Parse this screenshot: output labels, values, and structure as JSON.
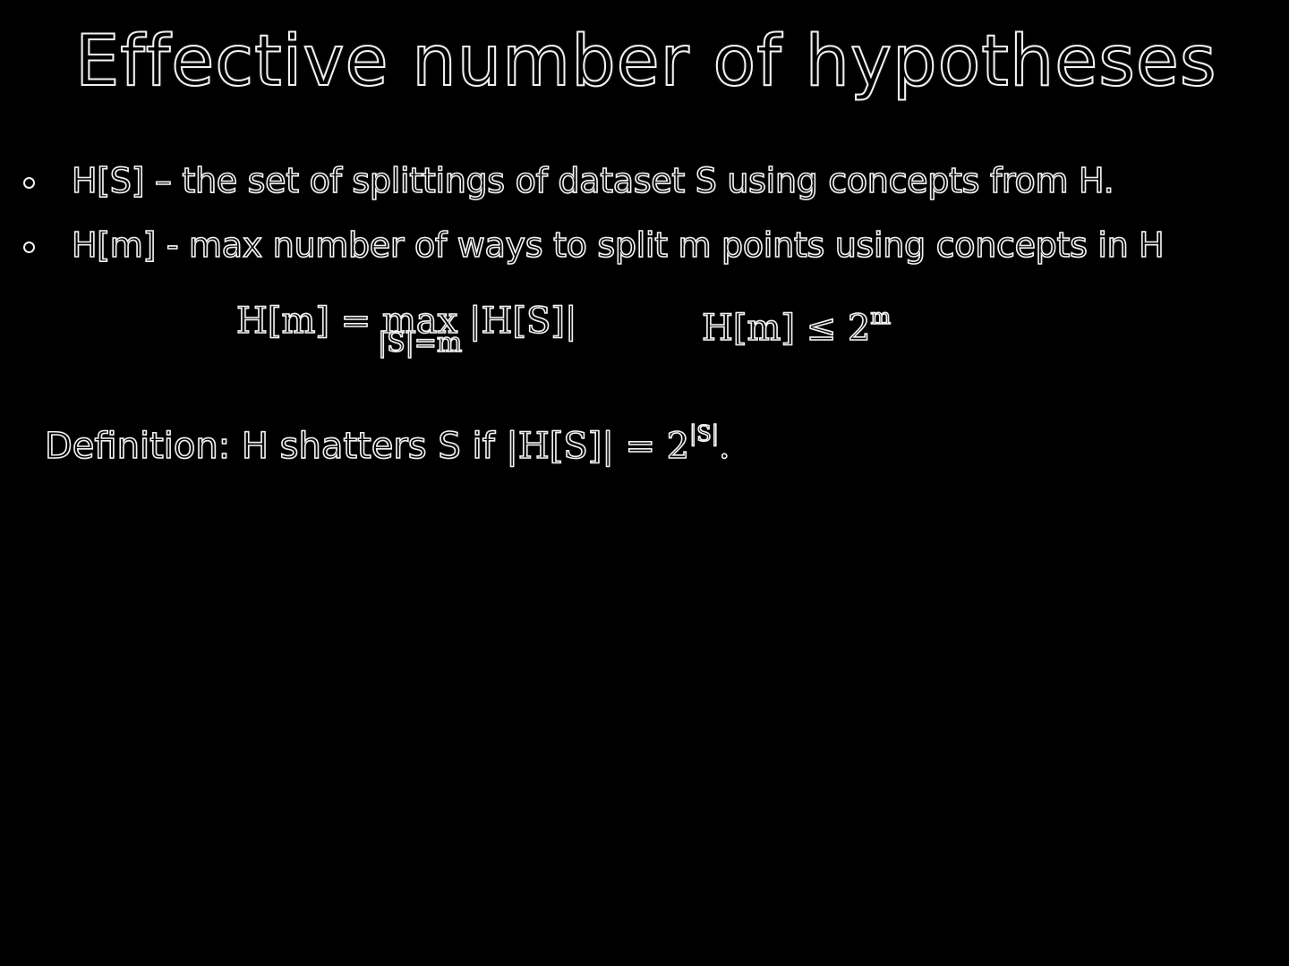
{
  "slide": {
    "title": "Effective number of hypotheses",
    "bullets": [
      {
        "text": "H[S] – the set of splittings of dataset S using concepts from H."
      },
      {
        "text": "H[m] - max number of ways to split m points using concepts in H"
      }
    ],
    "formula_max": {
      "lhs": "H[m] =",
      "operator": "max",
      "subscript": "|S|=m",
      "rhs": "|H[S]|"
    },
    "formula_bound": {
      "lhs": "H[m] ≤ 2",
      "exponent": "m"
    },
    "definition": {
      "text": "Definition: H shatters S if",
      "math": "|H[S]| = 2",
      "exponent": "|S|",
      "end": "."
    }
  }
}
